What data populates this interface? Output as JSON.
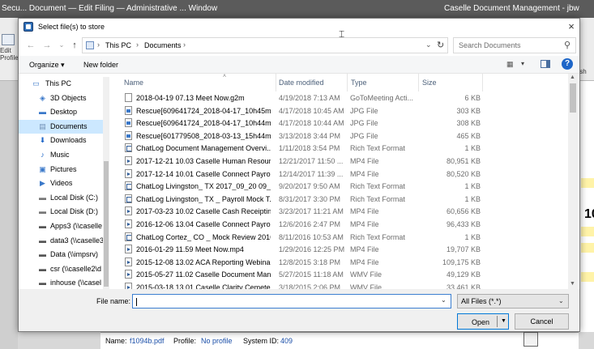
{
  "background": {
    "title_left": "Secu... Document — Edit Filing — Administrative ... Window",
    "title_right": "Caselle Document Management - jbw",
    "edit_label": "Edit Profile",
    "right_label": "nish",
    "doc_number": "10",
    "status": {
      "name_label": "Name:",
      "name_value": "f1094b.pdf",
      "profile_label": "Profile:",
      "profile_value": "No profile",
      "sysid_label": "System ID:",
      "sysid_value": "409"
    }
  },
  "dialog": {
    "title": "Select file(s) to store",
    "close_icon": "×",
    "address": {
      "crumbs": [
        "This PC",
        "Documents"
      ]
    },
    "search_placeholder": "Search Documents",
    "toolbar": {
      "organize": "Organize ▾",
      "new_folder": "New folder"
    },
    "nav_items": [
      {
        "label": "This PC",
        "icon": "computer-icon",
        "indent": 0
      },
      {
        "label": "3D Objects",
        "icon": "cube-icon",
        "indent": 1
      },
      {
        "label": "Desktop",
        "icon": "desktop-icon",
        "indent": 1
      },
      {
        "label": "Documents",
        "icon": "documents-icon",
        "indent": 1,
        "selected": true
      },
      {
        "label": "Downloads",
        "icon": "download-icon",
        "indent": 1
      },
      {
        "label": "Music",
        "icon": "music-icon",
        "indent": 1
      },
      {
        "label": "Pictures",
        "icon": "pictures-icon",
        "indent": 1
      },
      {
        "label": "Videos",
        "icon": "video-icon",
        "indent": 1
      },
      {
        "label": "Local Disk (C:)",
        "icon": "disk-icon",
        "indent": 1
      },
      {
        "label": "Local Disk (D:)",
        "icon": "disk-icon",
        "indent": 1
      },
      {
        "label": "Apps3 (\\\\caselle",
        "icon": "network-drive-icon",
        "indent": 1
      },
      {
        "label": "data3 (\\\\caselle3",
        "icon": "network-drive-icon",
        "indent": 1
      },
      {
        "label": "Data (\\\\impsrv)",
        "icon": "network-drive-icon",
        "indent": 1
      },
      {
        "label": "csr (\\\\caselle2\\d",
        "icon": "network-drive-icon",
        "indent": 1
      },
      {
        "label": "inhouse (\\\\casel",
        "icon": "network-drive-icon",
        "indent": 1
      }
    ],
    "columns": [
      "Name",
      "Date modified",
      "Type",
      "Size"
    ],
    "files": [
      {
        "name": "2018-04-19 07.13 Meet Now.g2m",
        "date": "4/19/2018 7:13 AM",
        "type": "GoToMeeting Acti...",
        "size": "6 KB",
        "kind": "doc"
      },
      {
        "name": "Rescue[609641724_2018-04-17_10h45m02...",
        "date": "4/17/2018 10:45 AM",
        "type": "JPG File",
        "size": "303 KB",
        "kind": "img"
      },
      {
        "name": "Rescue[609641724_2018-04-17_10h44m50...",
        "date": "4/17/2018 10:44 AM",
        "type": "JPG File",
        "size": "308 KB",
        "kind": "img"
      },
      {
        "name": "Rescue[601779508_2018-03-13_15h44m08...",
        "date": "3/13/2018 3:44 PM",
        "type": "JPG File",
        "size": "465 KB",
        "kind": "img"
      },
      {
        "name": "ChatLog Document Management Overvi...",
        "date": "1/11/2018 3:54 PM",
        "type": "Rich Text Format",
        "size": "1 KB",
        "kind": "rtf"
      },
      {
        "name": "2017-12-21 10.03 Caselle Human Resourc...",
        "date": "12/21/2017 11:50 ...",
        "type": "MP4 File",
        "size": "80,951 KB",
        "kind": "vid"
      },
      {
        "name": "2017-12-14 10.01 Caselle Connect Payroll...",
        "date": "12/14/2017 11:39 ...",
        "type": "MP4 File",
        "size": "80,520 KB",
        "kind": "vid"
      },
      {
        "name": "ChatLog Livingston_ TX 2017_09_20 09_5...",
        "date": "9/20/2017 9:50 AM",
        "type": "Rich Text Format",
        "size": "1 KB",
        "kind": "rtf"
      },
      {
        "name": "ChatLog Livingston_ TX _ Payroll Mock T...",
        "date": "8/31/2017 3:30 PM",
        "type": "Rich Text Format",
        "size": "1 KB",
        "kind": "rtf"
      },
      {
        "name": "2017-03-23 10.02 Caselle Cash Receipting...",
        "date": "3/23/2017 11:21 AM",
        "type": "MP4 File",
        "size": "60,656 KB",
        "kind": "vid"
      },
      {
        "name": "2016-12-06 13.04 Caselle Connect Payroll...",
        "date": "12/6/2016 2:47 PM",
        "type": "MP4 File",
        "size": "96,433 KB",
        "kind": "vid"
      },
      {
        "name": "ChatLog Cortez_ CO _ Mock Review 2016...",
        "date": "8/11/2016 10:53 AM",
        "type": "Rich Text Format",
        "size": "1 KB",
        "kind": "rtf"
      },
      {
        "name": "2016-01-29 11.59 Meet Now.mp4",
        "date": "1/29/2016 12:25 PM",
        "type": "MP4 File",
        "size": "19,707 KB",
        "kind": "vid"
      },
      {
        "name": "2015-12-08 13.02 ACA Reporting Webinar...",
        "date": "12/8/2015 3:18 PM",
        "type": "MP4 File",
        "size": "109,175 KB",
        "kind": "vid"
      },
      {
        "name": "2015-05-27 11.02 Caselle Document Man...",
        "date": "5/27/2015 11:18 AM",
        "type": "WMV File",
        "size": "49,129 KB",
        "kind": "vid"
      },
      {
        "name": "2015-03-18 13.01 Caselle Clarity Cemeter...",
        "date": "3/18/2015 2:06 PM",
        "type": "WMV File",
        "size": "33,461 KB",
        "kind": "vid"
      }
    ],
    "filename_label": "File name:",
    "filename_value": "",
    "filter_value": "All Files (*.*)",
    "open_label": "Open",
    "cancel_label": "Cancel"
  }
}
